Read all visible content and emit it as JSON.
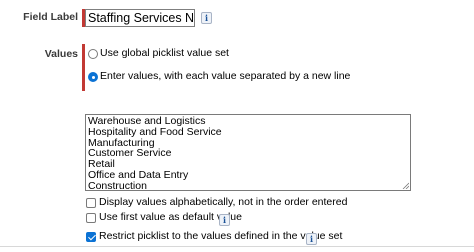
{
  "field_label": {
    "label": "Field Label",
    "value": "Staffing Services Neede",
    "info": "i"
  },
  "values": {
    "label": "Values",
    "options": [
      {
        "label": "Use global picklist value set",
        "selected": false
      },
      {
        "label": "Enter values, with each value separated by a new line",
        "selected": true
      }
    ],
    "entries": [
      "Warehouse and Logistics",
      "Hospitality and Food Service",
      "Manufacturing",
      "Customer Service",
      "Retail",
      "Office and Data Entry",
      "Construction"
    ]
  },
  "checkboxes": [
    {
      "label": "Display values alphabetically, not in the order entered",
      "checked": false,
      "info": ""
    },
    {
      "label": "Use first value as default value",
      "checked": false,
      "info": "i"
    },
    {
      "label": "Restrict picklist to the values defined in the value set",
      "checked": true,
      "info": "i"
    }
  ],
  "colors": {
    "required_bar": "#c23934",
    "accent": "#0b72d4",
    "info_icon": "#1b5297"
  },
  "icons": {
    "info": "info-icon",
    "resize": "resize-grip-icon"
  }
}
